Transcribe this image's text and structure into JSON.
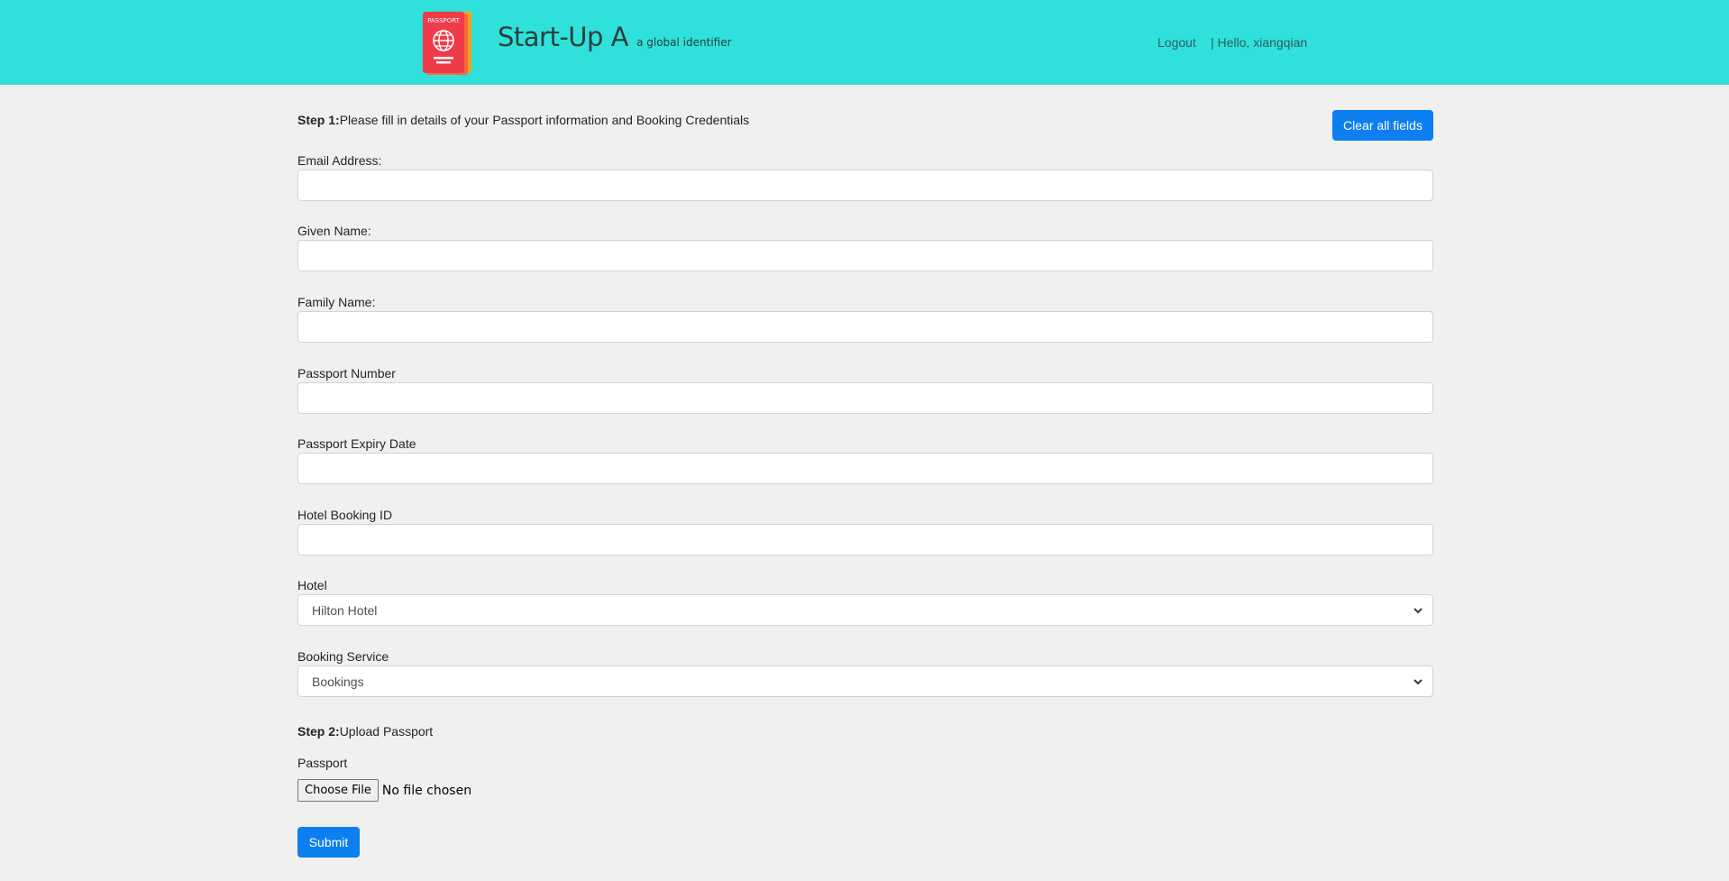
{
  "header": {
    "logo_icon": "passport-icon",
    "logo_text": "PASSPORT",
    "title": "Start-Up A",
    "tagline": "a global identifier",
    "logout": "Logout",
    "greeting": "| Hello, xiangqian",
    "bg_color": "#30e0da"
  },
  "form": {
    "step1_label": "Step 1:",
    "step1_text": "Please fill in details of your Passport information and Booking Credentials",
    "clear_button": "Clear all fields",
    "fields": [
      {
        "label": "Email Address:",
        "value": ""
      },
      {
        "label": "Given Name:",
        "value": ""
      },
      {
        "label": "Family Name:",
        "value": ""
      },
      {
        "label": "Passport Number",
        "value": ""
      },
      {
        "label": "Passport Expiry Date",
        "value": ""
      },
      {
        "label": "Hotel Booking ID",
        "value": ""
      }
    ],
    "hotel": {
      "label": "Hotel",
      "selected": "Hilton Hotel"
    },
    "booking_service": {
      "label": "Booking Service",
      "selected": "Bookings"
    },
    "step2_label": "Step 2:",
    "step2_text": "Upload Passport",
    "passport_label": "Passport",
    "choose_file": "Choose File",
    "file_status": "No file chosen",
    "submit": "Submit",
    "accent_color": "#0d7ff0"
  }
}
